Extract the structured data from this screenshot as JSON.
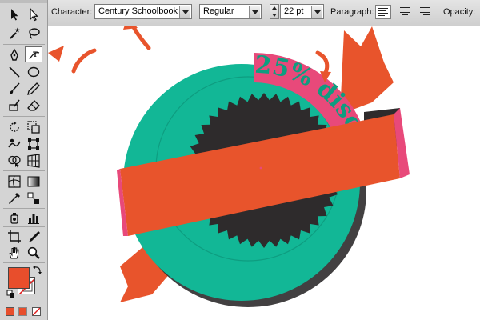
{
  "control_bar": {
    "character_label": "Character:",
    "font_family_value": "Century Schoolbook",
    "font_style_value": "Regular",
    "font_size_value": "22 pt",
    "paragraph_label": "Paragraph:",
    "opacity_label": "Opacity:"
  },
  "tools_panel": {
    "tools": [
      "selection-tool",
      "direct-selection-tool",
      "magic-wand-tool",
      "lasso-tool",
      "pen-tool",
      "type-on-path-tool",
      "line-segment-tool",
      "ellipse-tool",
      "paintbrush-tool",
      "pencil-tool",
      "blob-brush-tool",
      "eraser-tool",
      "rotate-tool",
      "scale-tool",
      "warp-tool",
      "free-transform-tool",
      "shape-builder-tool",
      "perspective-grid-tool",
      "mesh-tool",
      "gradient-tool",
      "eyedropper-tool",
      "blend-tool",
      "symbol-sprayer-tool",
      "column-graph-tool",
      "artboard-tool",
      "slice-tool",
      "hand-tool",
      "zoom-tool"
    ],
    "selected_tool": "type-on-path-tool",
    "fill_color": "#e84e2c",
    "stroke_color": "none"
  },
  "artwork": {
    "path_text": "25% disc",
    "colors": {
      "teal": "#12b796",
      "dark_teal": "#0e9d80",
      "charcoal": "#2e2b2c",
      "orange": "#e8542c",
      "pink": "#e8497a"
    }
  },
  "annotations": {
    "arrow_color": "#e8542c"
  }
}
